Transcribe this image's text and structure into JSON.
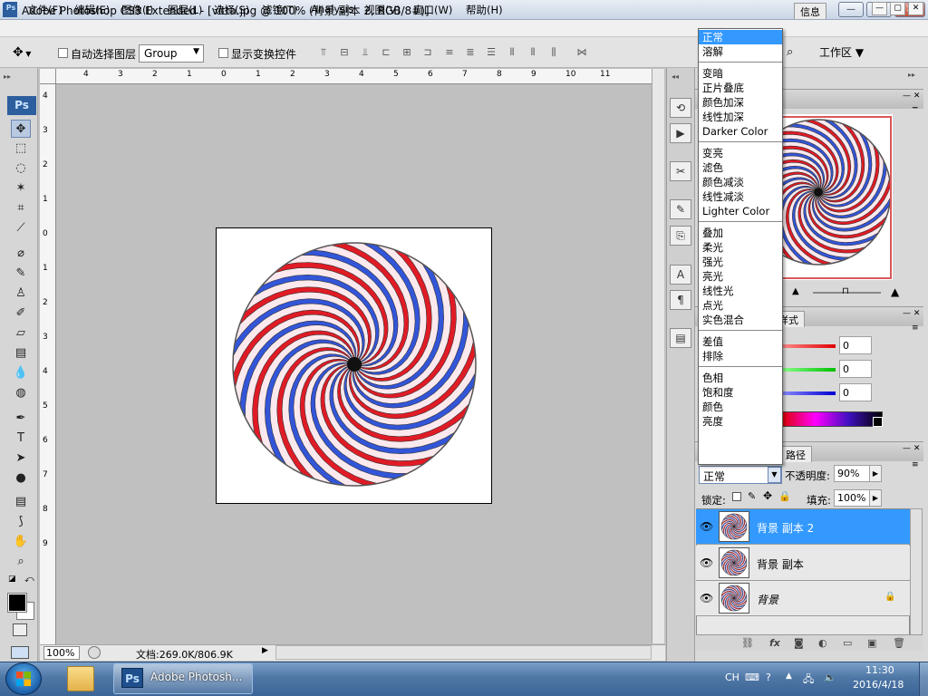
{
  "window": {
    "title": "Adobe Photoshop CS3 Extended - [vitta.jpg @ 100% (背景 副本 2, RGB/8#)]",
    "app_icon": "Ps",
    "min": "—",
    "max": "▢",
    "close": "✕"
  },
  "menubar": {
    "items": [
      "文件(F)",
      "编辑(E)",
      "图像(I)",
      "图层(L)",
      "选择(S)",
      "滤镜(T)",
      "Analysis",
      "视图(V)",
      "窗口(W)",
      "帮助(H)"
    ],
    "mdi": [
      "—",
      "▢",
      "✕"
    ]
  },
  "options": {
    "auto_select_label": "自动选择图层",
    "auto_select_value": "Group",
    "show_transform_label": "显示变换控件",
    "workspace_label": "工作区 ▼"
  },
  "toolbar": {
    "logo": "Ps",
    "tools": [
      {
        "name": "move-tool",
        "glyph": "✥"
      },
      {
        "name": "marquee-tool",
        "glyph": "⬚"
      },
      {
        "name": "lasso-tool",
        "glyph": "◌"
      },
      {
        "name": "magic-wand-tool",
        "glyph": "✶"
      },
      {
        "name": "crop-tool",
        "glyph": "⌗"
      },
      {
        "name": "slice-tool",
        "glyph": "⟋"
      },
      {
        "name": "healing-brush-tool",
        "glyph": "⌀"
      },
      {
        "name": "brush-tool",
        "glyph": "✎"
      },
      {
        "name": "clone-stamp-tool",
        "glyph": "♙"
      },
      {
        "name": "history-brush-tool",
        "glyph": "✐"
      },
      {
        "name": "eraser-tool",
        "glyph": "▱"
      },
      {
        "name": "gradient-tool",
        "glyph": "▤"
      },
      {
        "name": "blur-tool",
        "glyph": "💧"
      },
      {
        "name": "dodge-tool",
        "glyph": "◍"
      },
      {
        "name": "pen-tool",
        "glyph": "✒"
      },
      {
        "name": "type-tool",
        "glyph": "T"
      },
      {
        "name": "path-selection-tool",
        "glyph": "➤"
      },
      {
        "name": "shape-tool",
        "glyph": "●"
      },
      {
        "name": "notes-tool",
        "glyph": "▤"
      },
      {
        "name": "eyedropper-tool",
        "glyph": "⟆"
      },
      {
        "name": "hand-tool",
        "glyph": "✋"
      },
      {
        "name": "zoom-tool",
        "glyph": "⌕"
      }
    ]
  },
  "rulers": {
    "top": [
      "4",
      "3",
      "2",
      "1",
      "0",
      "1",
      "2",
      "3",
      "4",
      "5",
      "6",
      "7",
      "8",
      "9",
      "10",
      "11"
    ],
    "left": [
      "4",
      "3",
      "2",
      "1",
      "0",
      "1",
      "2",
      "3",
      "4",
      "5",
      "6",
      "7",
      "8",
      "9"
    ]
  },
  "status": {
    "zoom": "100%",
    "doc_info": "文档:269.0K/806.9K"
  },
  "panels": {
    "navigator_tab": "信息",
    "color_tab": "样式",
    "layers_tab": "路径",
    "color_values": [
      "0",
      "0",
      "0"
    ],
    "blend_mode_value": "正常",
    "opacity_label": "不透明度:",
    "opacity_value": "90%",
    "lock_label": "锁定:",
    "fill_label": "填充:",
    "fill_value": "100%",
    "layers": [
      {
        "name": "背景 副本 2",
        "selected": true,
        "locked": false
      },
      {
        "name": "背景 副本",
        "selected": false,
        "locked": false
      },
      {
        "name": "背景",
        "selected": false,
        "locked": true
      }
    ]
  },
  "blend_dropdown": {
    "groups": [
      [
        "正常",
        "溶解"
      ],
      [
        "变暗",
        "正片叠底",
        "颜色加深",
        "线性加深",
        "Darker Color"
      ],
      [
        "变亮",
        "滤色",
        "颜色减淡",
        "线性减淡",
        "Lighter Color"
      ],
      [
        "叠加",
        "柔光",
        "强光",
        "亮光",
        "线性光",
        "点光",
        "实色混合"
      ],
      [
        "差值",
        "排除"
      ],
      [
        "色相",
        "饱和度",
        "颜色",
        "亮度"
      ]
    ],
    "selected": "正常"
  },
  "taskbar": {
    "ps_label": "Adobe Photosh...",
    "tray_lang": "CH",
    "time": "11:30",
    "date": "2016/4/18"
  },
  "colors": {
    "accent_blue": "#3399ff",
    "swirl_red": "#e01b25",
    "swirl_blue": "#3355d8"
  }
}
